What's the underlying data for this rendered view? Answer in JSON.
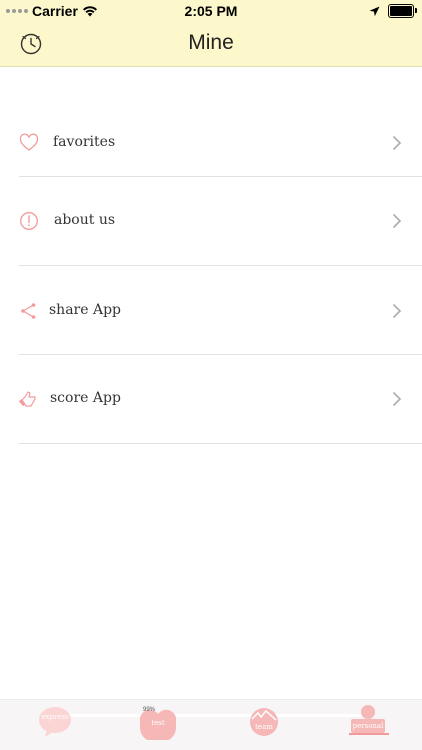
{
  "status_bar": {
    "carrier": "Carrier",
    "time": "2:05 PM"
  },
  "nav": {
    "title": "Mine",
    "left_icon": "clock-icon"
  },
  "menu": {
    "items": [
      {
        "label": "favorites",
        "icon": "heart-icon"
      },
      {
        "label": "about us",
        "icon": "info-circle-icon"
      },
      {
        "label": "share App",
        "icon": "share-icon"
      },
      {
        "label": "score App",
        "icon": "thumbs-up-icon"
      }
    ],
    "chevron_icon": "chevron-right-icon"
  },
  "tab_bar": {
    "tabs": [
      {
        "label": "express",
        "icon": "express-tab-icon"
      },
      {
        "label": "test",
        "badge": "99%",
        "icon": "test-tab-icon"
      },
      {
        "label": "team",
        "icon": "team-tab-icon"
      },
      {
        "label": "personal",
        "icon": "personal-tab-icon"
      }
    ],
    "selected": "personal"
  },
  "colors": {
    "header_bg": "#fdf8cc",
    "accent_pink": "#f29a9a",
    "divider": "#e2e2e2",
    "chevron": "#b0b0b0"
  }
}
